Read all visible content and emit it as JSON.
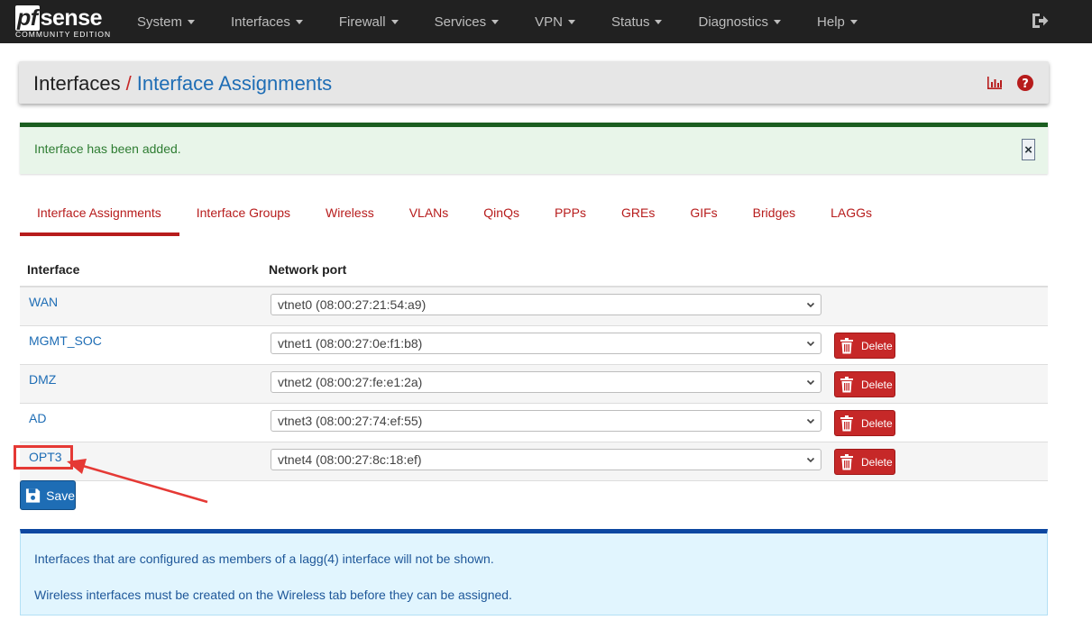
{
  "navbar": {
    "logo_main": "sense",
    "logo_pf": "pf",
    "logo_sub": "COMMUNITY EDITION",
    "menu": [
      {
        "label": "System"
      },
      {
        "label": "Interfaces"
      },
      {
        "label": "Firewall"
      },
      {
        "label": "Services"
      },
      {
        "label": "VPN"
      },
      {
        "label": "Status"
      },
      {
        "label": "Diagnostics"
      },
      {
        "label": "Help"
      }
    ],
    "logout_icon": "sign-out-icon"
  },
  "breadcrumb": {
    "root": "Interfaces",
    "separator": "/",
    "current": "Interface Assignments",
    "icons": [
      "bar-chart-icon",
      "help-question-icon"
    ]
  },
  "alert_success": {
    "message": "Interface has been added.",
    "close": "×"
  },
  "tabs": [
    {
      "label": "Interface Assignments",
      "active": true
    },
    {
      "label": "Interface Groups"
    },
    {
      "label": "Wireless"
    },
    {
      "label": "VLANs"
    },
    {
      "label": "QinQs"
    },
    {
      "label": "PPPs"
    },
    {
      "label": "GREs"
    },
    {
      "label": "GIFs"
    },
    {
      "label": "Bridges"
    },
    {
      "label": "LAGGs"
    }
  ],
  "table": {
    "headers": {
      "interface": "Interface",
      "network_port": "Network port"
    },
    "rows": [
      {
        "interface": "WAN",
        "port": "vtnet0 (08:00:27:21:54:a9)",
        "deletable": false
      },
      {
        "interface": "MGMT_SOC",
        "port": "vtnet1 (08:00:27:0e:f1:b8)",
        "deletable": true
      },
      {
        "interface": "DMZ",
        "port": "vtnet2 (08:00:27:fe:e1:2a)",
        "deletable": true
      },
      {
        "interface": "AD",
        "port": "vtnet3 (08:00:27:74:ef:55)",
        "deletable": true
      },
      {
        "interface": "OPT3",
        "port": "vtnet4 (08:00:27:8c:18:ef)",
        "deletable": true
      }
    ],
    "delete_label": "Delete"
  },
  "save_label": "Save",
  "alert_info": {
    "lines": [
      "Interfaces that are configured as members of a lagg(4) interface will not be shown.",
      "Wireless interfaces must be created on the Wireless tab before they can be assigned."
    ]
  },
  "colors": {
    "navbar": "#212121",
    "accent_red": "#b71c1c",
    "link_blue": "#1e6db5",
    "success_green": "#1b5e20",
    "info_blue": "#0d47a1"
  }
}
